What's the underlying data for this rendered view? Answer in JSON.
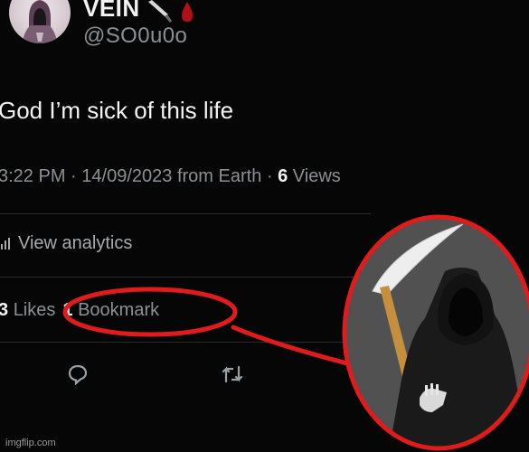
{
  "profile": {
    "display_name": "VEIN",
    "handle": "@SO0u0o",
    "avatar_icon": "hooded-figure-avatar",
    "name_emoji_icons": [
      "knife-icon",
      "blood-drop-icon"
    ]
  },
  "tweet": {
    "text": "God I’m sick of this life",
    "time": "3:22 PM",
    "date": "14/09/2023",
    "source": "from Earth",
    "views_count": "6",
    "views_label": "Views",
    "separator": "·"
  },
  "analytics": {
    "label": "View analytics",
    "icon": "analytics-icon"
  },
  "stats": {
    "likes_count": "3",
    "likes_label": "Likes",
    "bookmark_count": "1",
    "bookmark_label": "Bookmark"
  },
  "actions": {
    "reply_icon": "reply-icon",
    "retweet_icon": "retweet-icon"
  },
  "overlay": {
    "annotation_color": "#e01b1b",
    "inset_image": "grim-reaper-with-scythe"
  },
  "watermark": "imgflip.com",
  "colors": {
    "background": "#060606",
    "primary_text": "#e7e9ea",
    "secondary_text": "#8b9096"
  }
}
